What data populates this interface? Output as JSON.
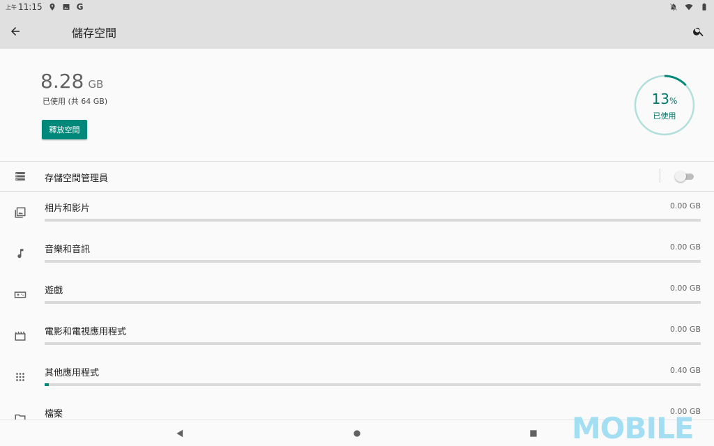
{
  "status_bar": {
    "ampm": "上午",
    "time": "11:15",
    "left_icons": [
      "location-icon",
      "gallery-icon",
      "google-icon"
    ],
    "google_letter": "G",
    "right_icons": [
      "notifications-off-icon",
      "wifi-icon",
      "battery-icon"
    ]
  },
  "app_bar": {
    "title": "儲存空間",
    "back_icon": "arrow-left-icon",
    "search_icon": "search-icon"
  },
  "summary": {
    "used_value": "8.28",
    "used_unit": "GB",
    "used_sub": "已使用 (共 64 GB)",
    "free_button": "釋放空間",
    "percent": "13",
    "percent_sign": "%",
    "percent_fraction": 0.13,
    "percent_label": "已使用"
  },
  "storage_manager": {
    "label": "存儲空間管理員",
    "icon": "storage-list-icon",
    "enabled": false
  },
  "categories": [
    {
      "label": "相片和影片",
      "size": "0.00 GB",
      "icon": "photo-icon",
      "fraction": 0
    },
    {
      "label": "音樂和音訊",
      "size": "0.00 GB",
      "icon": "music-note-icon",
      "fraction": 0
    },
    {
      "label": "遊戲",
      "size": "0.00 GB",
      "icon": "gamepad-icon",
      "fraction": 0
    },
    {
      "label": "電影和電視應用程式",
      "size": "0.00 GB",
      "icon": "movie-icon",
      "fraction": 0
    },
    {
      "label": "其他應用程式",
      "size": "0.40 GB",
      "icon": "apps-grid-icon",
      "fraction": 0.006
    },
    {
      "label": "檔案",
      "size": "0.00 GB",
      "icon": "folder-icon",
      "fraction": 0
    }
  ],
  "colors": {
    "accent": "#00897b",
    "gauge_track": "#b2dfdb",
    "gauge_arc": "#00897b"
  },
  "watermark": "MOBILE"
}
